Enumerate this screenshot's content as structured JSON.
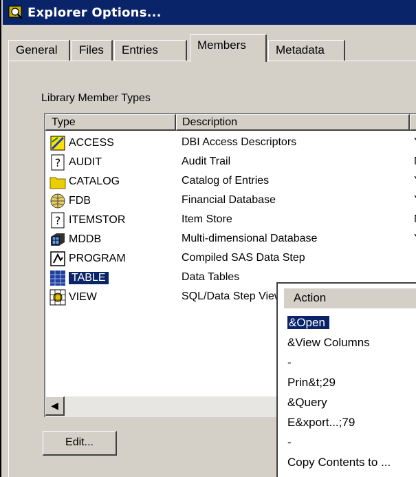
{
  "window": {
    "title": "Explorer Options..."
  },
  "tabs": [
    {
      "label": "General"
    },
    {
      "label": "Files"
    },
    {
      "label": "Entries"
    },
    {
      "label": "Members",
      "active": true
    },
    {
      "label": "Metadata"
    }
  ],
  "group_label": "Library Member Types",
  "columns": [
    "Type",
    "Description",
    "V"
  ],
  "rows": [
    {
      "type": "ACCESS",
      "desc": "DBI Access Descriptors",
      "flag": "Y",
      "icon": "access-descriptor-icon"
    },
    {
      "type": "AUDIT",
      "desc": "Audit Trail",
      "flag": "N",
      "icon": "question-mark-icon"
    },
    {
      "type": "CATALOG",
      "desc": "Catalog of Entries",
      "flag": "Y",
      "icon": "folder-icon"
    },
    {
      "type": "FDB",
      "desc": "Financial Database",
      "flag": "Y",
      "icon": "globe-icon"
    },
    {
      "type": "ITEMSTOR",
      "desc": "Item Store",
      "flag": "N",
      "icon": "question-mark-icon"
    },
    {
      "type": "MDDB",
      "desc": "Multi-dimensional Database",
      "flag": "Y",
      "icon": "cube-icon"
    },
    {
      "type": "PROGRAM",
      "desc": "Compiled SAS Data Step",
      "flag": "",
      "icon": "program-icon"
    },
    {
      "type": "TABLE",
      "desc": "Data Tables",
      "flag": "",
      "icon": "table-icon",
      "selected": true
    },
    {
      "type": "VIEW",
      "desc": "SQL/Data Step View",
      "flag": "",
      "icon": "view-icon"
    }
  ],
  "edit_button": "Edit...",
  "actions_header": "Action",
  "actions": [
    {
      "label": "&Open",
      "selected": true
    },
    {
      "label": "&View Columns"
    },
    {
      "label": "-"
    },
    {
      "label": "Prin&t;29"
    },
    {
      "label": "&Query"
    },
    {
      "label": "E&xport...;79"
    },
    {
      "label": "-"
    },
    {
      "label": "Copy Contents to ..."
    }
  ]
}
